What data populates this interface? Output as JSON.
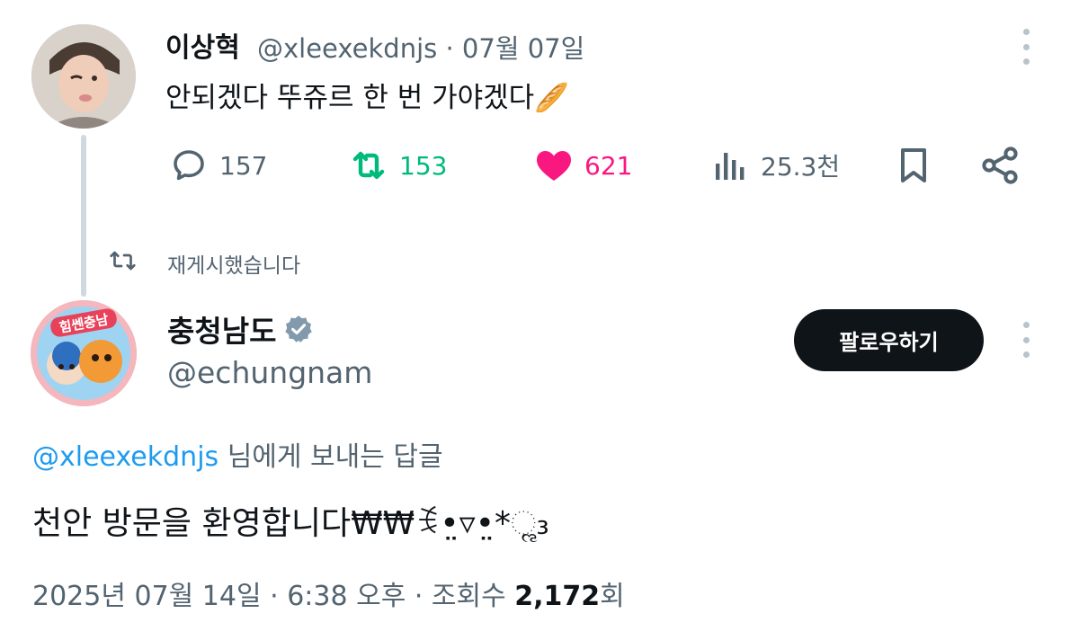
{
  "parent_tweet": {
    "author_name": "이상혁",
    "handle": "@xleexekdnjs",
    "separator": "·",
    "date": "07월 07일",
    "text": "안되겠다 뚜쥬르 한 번 가야겠다🥖",
    "actions": {
      "replies": "157",
      "retweets": "153",
      "likes": "621",
      "views": "25.3천"
    },
    "colors": {
      "retweet": "#00ba7c",
      "like": "#f91880",
      "muted": "#536471"
    }
  },
  "retweet_label": "재게시했습니다",
  "reply_tweet": {
    "author_name": "충청남도",
    "verified_icon": "verified-badge-icon",
    "handle": "@echungnam",
    "follow_label": "팔로우하기",
    "reply_to_mention": "@xleexekdnjs",
    "reply_to_suffix": " 님에게 보내는 답글",
    "text": "천안 방문을 환영합니다₩₩ꉂ•̤▿•̤*ૢ₃",
    "meta": {
      "date": "2025년 07월 14일",
      "separator": " · ",
      "time": "6:38 오후",
      "views_label": "조회수 ",
      "views_count": "2,172",
      "views_suffix": "회"
    },
    "avatar_logo_text": "힘쎈충남",
    "colors": {
      "mention": "#1d9bf0",
      "follow_bg": "#0f1419"
    }
  }
}
